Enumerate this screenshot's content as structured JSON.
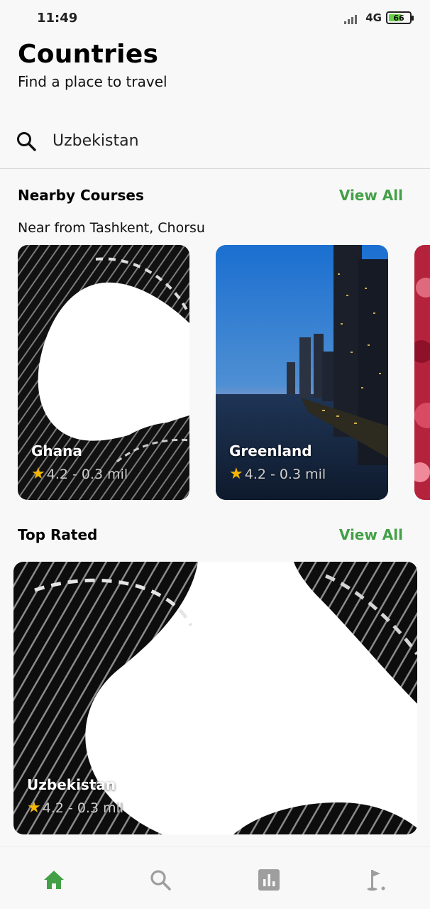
{
  "status_bar": {
    "time": "11:49",
    "network": "4G",
    "battery": "66",
    "battery_level": 0.66,
    "icons": [
      "signal-icon",
      "battery-icon"
    ]
  },
  "header": {
    "title": "Countries",
    "subtitle": "Find a place to travel"
  },
  "search": {
    "value": "Uzbekistan",
    "placeholder": "",
    "icon": "search-icon"
  },
  "nearby": {
    "title": "Nearby Courses",
    "view_all": "View All",
    "subtitle": "Near from Tashkent, Chorsu",
    "cards": [
      {
        "name": "Ghana",
        "rating": "4.2",
        "separator": "-",
        "size": "0.3 mil",
        "image": "abstract-architecture-image"
      },
      {
        "name": "Greenland",
        "rating": "4.2",
        "separator": "-",
        "size": "0.3 mil",
        "image": "city-skyline-image"
      },
      {
        "name": "",
        "rating": "",
        "separator": "",
        "size": "",
        "image": "flowers-image"
      }
    ]
  },
  "top_rated": {
    "title": "Top Rated",
    "view_all": "View All",
    "card": {
      "name": "Uzbekistan",
      "rating": "4.2",
      "separator": "-",
      "size": "0.3 mil",
      "image": "abstract-architecture-image"
    }
  },
  "bottom_nav": {
    "items": [
      {
        "icon": "home-icon",
        "active": true
      },
      {
        "icon": "search-icon",
        "active": false
      },
      {
        "icon": "stats-icon",
        "active": false
      },
      {
        "icon": "golf-flag-icon",
        "active": false
      }
    ],
    "active_color": "#43a047",
    "inactive_color": "#9e9e9e"
  },
  "colors": {
    "accent": "#43a047",
    "star": "#f5b700",
    "background": "#f8f8f8"
  }
}
